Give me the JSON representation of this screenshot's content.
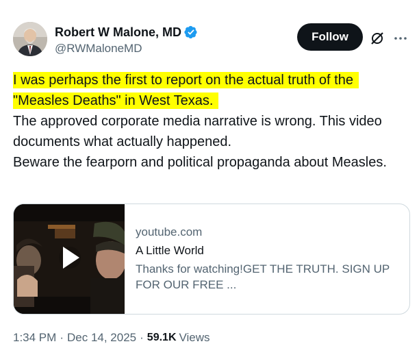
{
  "author": {
    "name": "Robert W Malone, MD",
    "handle": "@RWMaloneMD",
    "verified": true
  },
  "actions": {
    "follow_label": "Follow",
    "grok_icon": "grok-slash-circle-icon",
    "more_icon": "more-horizontal-icon"
  },
  "tweet": {
    "highlight_line1": "I was perhaps the first to report on the actual truth of the",
    "highlight_line2": "\"Measles Deaths\" in West Texas.",
    "body_para1": "The approved corporate media narrative is wrong. This video documents what actually happened.",
    "body_para2": "Beware the fearporn and political propaganda about Measles."
  },
  "link_card": {
    "domain": "youtube.com",
    "title": "A Little World",
    "description": "Thanks for watching!GET THE TRUTH. SIGN UP FOR OUR FREE ...",
    "play_icon": "play-icon"
  },
  "meta": {
    "time": "1:34 PM",
    "date": "Dec 14, 2025",
    "views_count": "59.1K",
    "views_label": "Views"
  },
  "colors": {
    "highlight": "#ffff00",
    "verified_blue": "#1d9bf0",
    "text_primary": "#0f1419",
    "text_secondary": "#536471",
    "follow_bg": "#0f1419"
  }
}
